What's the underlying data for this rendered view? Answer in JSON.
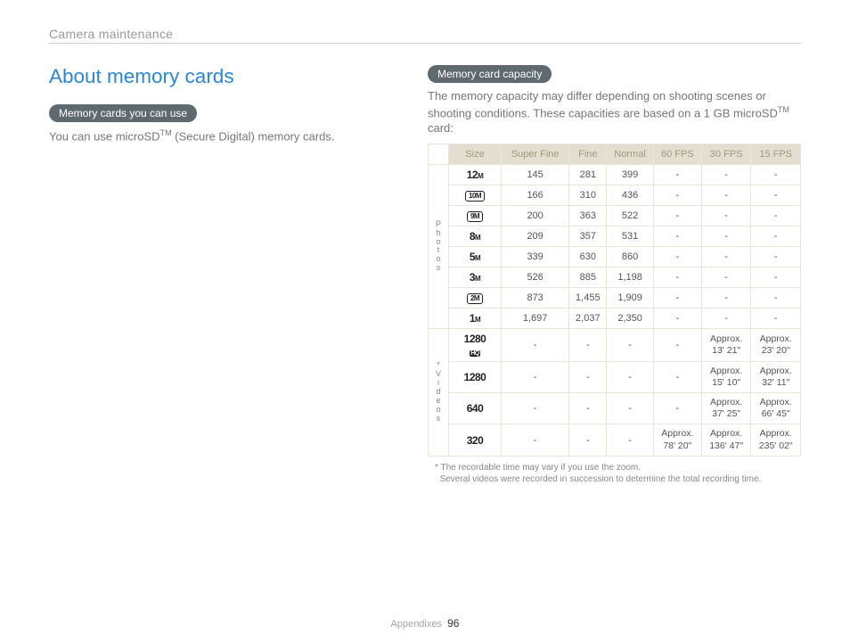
{
  "header": {
    "title": "Camera maintenance"
  },
  "left": {
    "section_title": "About memory cards",
    "pill": "Memory cards you can use",
    "body_pre": "You can use microSD",
    "body_sup": "TM",
    "body_post": " (Secure Digital) memory cards."
  },
  "right": {
    "pill": "Memory card capacity",
    "body_pre": "The memory capacity may differ depending on shooting scenes or shooting conditions. These capacities are based on a 1 GB microSD",
    "body_sup": "TM",
    "body_post": " card:"
  },
  "table": {
    "headers": {
      "size": "Size",
      "c1": "Super Fine",
      "c2": "Fine",
      "c3": "Normal",
      "c4": "60 FPS",
      "c5": "30 FPS",
      "c6": "15 FPS"
    },
    "cat_photos": "Photos",
    "cat_videos": "Videos",
    "asterisk": "*"
  },
  "chart_data": {
    "type": "table",
    "photo_rows": [
      {
        "label": "12",
        "unit": "M",
        "badge": false,
        "c1": "145",
        "c2": "281",
        "c3": "399",
        "c4": "-",
        "c5": "-",
        "c6": "-"
      },
      {
        "label": "10",
        "unit": "M",
        "badge": true,
        "c1": "166",
        "c2": "310",
        "c3": "436",
        "c4": "-",
        "c5": "-",
        "c6": "-"
      },
      {
        "label": "9",
        "unit": "M",
        "badge": true,
        "c1": "200",
        "c2": "363",
        "c3": "522",
        "c4": "-",
        "c5": "-",
        "c6": "-"
      },
      {
        "label": "8",
        "unit": "M",
        "badge": false,
        "c1": "209",
        "c2": "357",
        "c3": "531",
        "c4": "-",
        "c5": "-",
        "c6": "-"
      },
      {
        "label": "5",
        "unit": "M",
        "badge": false,
        "c1": "339",
        "c2": "630",
        "c3": "860",
        "c4": "-",
        "c5": "-",
        "c6": "-"
      },
      {
        "label": "3",
        "unit": "M",
        "badge": false,
        "c1": "526",
        "c2": "885",
        "c3": "1,198",
        "c4": "-",
        "c5": "-",
        "c6": "-"
      },
      {
        "label": "2",
        "unit": "M",
        "badge": true,
        "c1": "873",
        "c2": "1,455",
        "c3": "1,909",
        "c4": "-",
        "c5": "-",
        "c6": "-"
      },
      {
        "label": "1",
        "unit": "M",
        "badge": false,
        "c1": "1,697",
        "c2": "2,037",
        "c3": "2,350",
        "c4": "-",
        "c5": "-",
        "c6": "-"
      }
    ],
    "video_rows": [
      {
        "label": "1280",
        "sub": "HQ",
        "c1": "-",
        "c2": "-",
        "c3": "-",
        "c4": "-",
        "c5": "Approx. 13' 21\"",
        "c6": "Approx. 23' 20\""
      },
      {
        "label": "1280",
        "sub": "",
        "c1": "-",
        "c2": "-",
        "c3": "-",
        "c4": "-",
        "c5": "Approx. 15' 10\"",
        "c6": "Approx. 32' 11\""
      },
      {
        "label": "640",
        "sub": "",
        "c1": "-",
        "c2": "-",
        "c3": "-",
        "c4": "-",
        "c5": "Approx. 37' 25\"",
        "c6": "Approx. 66' 45\""
      },
      {
        "label": "320",
        "sub": "",
        "c1": "-",
        "c2": "-",
        "c3": "-",
        "c4": "Approx. 78' 20\"",
        "c5": "Approx. 136' 47\"",
        "c6": "Approx. 235' 02\""
      }
    ]
  },
  "footnote": {
    "line1": "* The recordable time may vary if you use the zoom.",
    "line2": "Several videos were recorded in succession to determine the total recording time."
  },
  "footer": {
    "section": "Appendixes",
    "page": "96"
  }
}
